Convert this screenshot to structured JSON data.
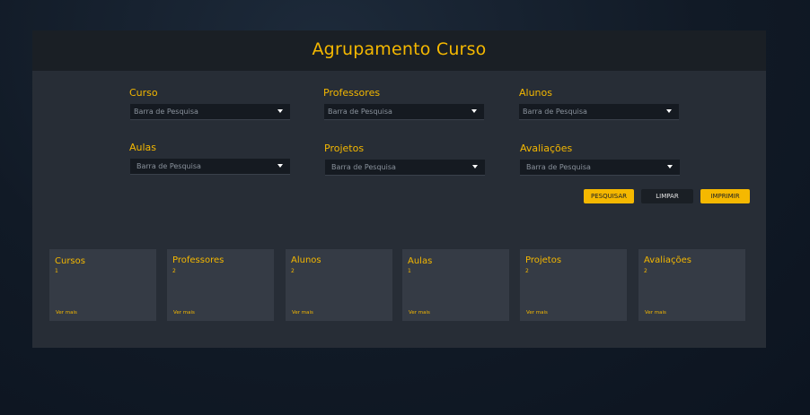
{
  "title": "Agrupamento Curso",
  "filters": [
    {
      "label": "Curso",
      "placeholder": "Barra de Pesquisa"
    },
    {
      "label": "Professores",
      "placeholder": "Barra de Pesquisa"
    },
    {
      "label": "Alunos",
      "placeholder": "Barra de Pesquisa"
    },
    {
      "label": "Aulas",
      "placeholder": "Barra de Pesquisa"
    },
    {
      "label": "Projetos",
      "placeholder": "Barra de Pesquisa"
    },
    {
      "label": "Avaliações",
      "placeholder": "Barra de Pesquisa"
    }
  ],
  "actions": {
    "search": "PESQUISAR",
    "clear": "LIMPAR",
    "print": "IMPRIMIR"
  },
  "cards": [
    {
      "title": "Cursos",
      "count": "1",
      "link": "Ver mais"
    },
    {
      "title": "Professores",
      "count": "2",
      "link": "Ver mais"
    },
    {
      "title": "Alunos",
      "count": "2",
      "link": "Ver mais"
    },
    {
      "title": "Aulas",
      "count": "1",
      "link": "Ver mais"
    },
    {
      "title": "Projetos",
      "count": "2",
      "link": "Ver mais"
    },
    {
      "title": "Avaliações",
      "count": "2",
      "link": "Ver mais"
    }
  ],
  "colors": {
    "accent": "#f5b800",
    "panel": "#272d36",
    "header": "#1a1f25",
    "card": "#353b45"
  },
  "icons": {
    "dropdown": "caret-down-icon"
  }
}
